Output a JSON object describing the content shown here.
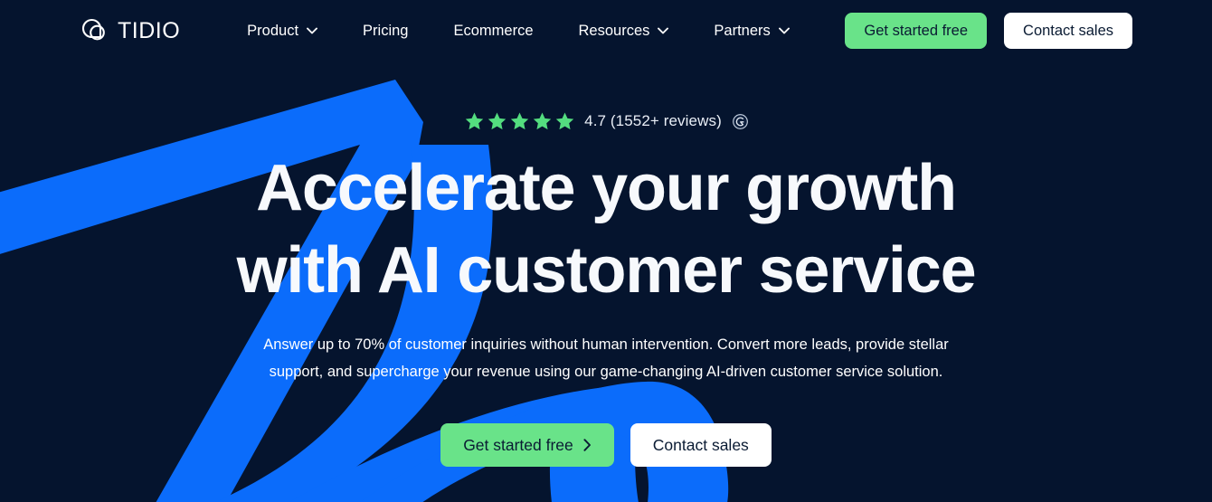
{
  "colors": {
    "background": "#05142e",
    "accent_blue": "#0b6cfb",
    "accent_green": "#69e389",
    "text_light": "#ffffff",
    "text_dark": "#0a1b33"
  },
  "header": {
    "brand": {
      "name": "TIDIO",
      "logo_icon": "tidio-bubble-logo-icon"
    },
    "nav": [
      {
        "label": "Product",
        "has_dropdown": true,
        "icon": "chevron-down-icon"
      },
      {
        "label": "Pricing",
        "has_dropdown": false,
        "icon": ""
      },
      {
        "label": "Ecommerce",
        "has_dropdown": false,
        "icon": ""
      },
      {
        "label": "Resources",
        "has_dropdown": true,
        "icon": "chevron-down-icon"
      },
      {
        "label": "Partners",
        "has_dropdown": true,
        "icon": "chevron-down-icon"
      }
    ],
    "actions": {
      "primary_label": "Get started free",
      "secondary_label": "Contact sales"
    }
  },
  "hero": {
    "rating": {
      "stars_filled": 5,
      "stars_total": 5,
      "score": "4.7",
      "text": "4.7 (1552+ reviews)",
      "review_count": "1552+",
      "badge_icon": "g2-badge-icon"
    },
    "title_line_1": "Accelerate your growth",
    "title_line_2": "with AI customer service",
    "subtitle": "Answer up to 70% of customer inquiries without human intervention. Convert more leads, provide stellar support, and supercharge your revenue using our game-changing AI-driven customer service solution.",
    "actions": {
      "primary_label": "Get started free",
      "primary_icon": "chevron-right-icon",
      "secondary_label": "Contact sales"
    },
    "background_graphic": "blue-seven-stroke-decoration"
  }
}
